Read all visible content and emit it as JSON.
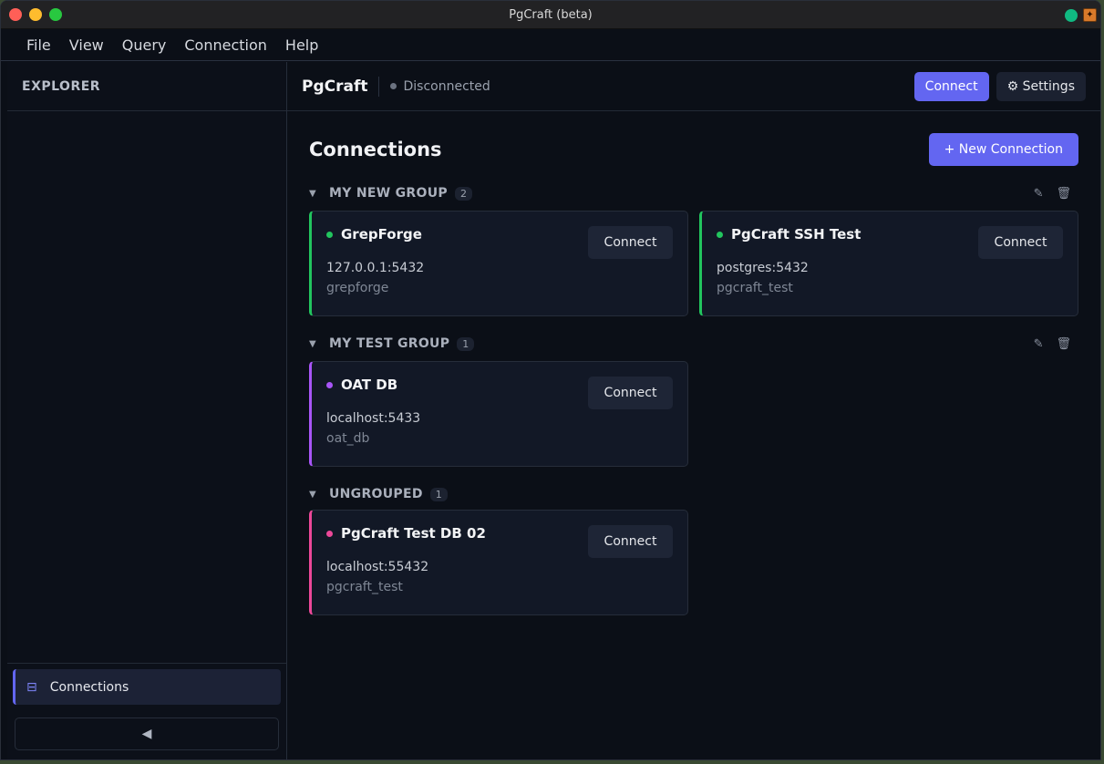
{
  "window": {
    "title": "PgCraft (beta)"
  },
  "menu": [
    "File",
    "View",
    "Query",
    "Connection",
    "Help"
  ],
  "sidebar": {
    "header": "EXPLORER",
    "nav_item": "Connections",
    "collapse_glyph": "◀"
  },
  "topbar": {
    "brand": "PgCraft",
    "status": "Disconnected",
    "connect_label": "Connect",
    "settings_label": "⚙ Settings"
  },
  "panel": {
    "title": "Connections",
    "new_label": "+ New Connection"
  },
  "groups": [
    {
      "name": "MY NEW GROUP",
      "count": "2",
      "connections": [
        {
          "name": "GrepForge",
          "host": "127.0.0.1:5432",
          "db": "grepforge",
          "color": "#22c55e",
          "connect": "Connect"
        },
        {
          "name": "PgCraft SSH Test",
          "host": "postgres:5432",
          "db": "pgcraft_test",
          "color": "#22c55e",
          "connect": "Connect"
        }
      ]
    },
    {
      "name": "MY TEST GROUP",
      "count": "1",
      "connections": [
        {
          "name": "OAT DB",
          "host": "localhost:5433",
          "db": "oat_db",
          "color": "#a855f7",
          "connect": "Connect"
        }
      ]
    },
    {
      "name": "UNGROUPED",
      "count": "1",
      "connections": [
        {
          "name": "PgCraft Test DB 02",
          "host": "localhost:55432",
          "db": "pgcraft_test",
          "color": "#ec4899",
          "connect": "Connect"
        }
      ]
    }
  ]
}
